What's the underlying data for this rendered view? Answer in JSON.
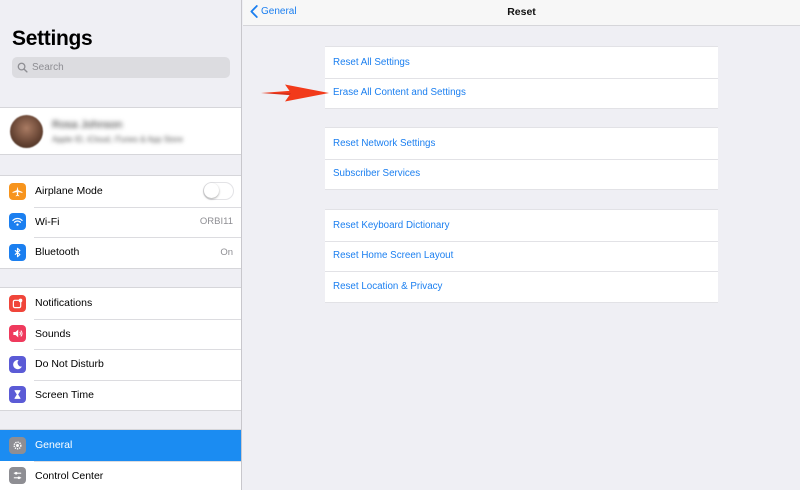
{
  "sidebar": {
    "title": "Settings",
    "search_placeholder": "Search",
    "profile": {
      "name": "Rosa Johnson",
      "subtitle": "Apple ID, iCloud, iTunes & App Store"
    },
    "groups": [
      [
        {
          "label": "Airplane Mode",
          "icon": "airplane-icon",
          "color": "#f7941d",
          "control": "toggle",
          "toggle_on": false
        },
        {
          "label": "Wi-Fi",
          "icon": "wifi-icon",
          "color": "#1b7ff0",
          "value": "ORBI11"
        },
        {
          "label": "Bluetooth",
          "icon": "bluetooth-icon",
          "color": "#1b7ff0",
          "value": "On"
        }
      ],
      [
        {
          "label": "Notifications",
          "icon": "notifications-icon",
          "color": "#f0453a"
        },
        {
          "label": "Sounds",
          "icon": "speaker-icon",
          "color": "#ef3a5d"
        },
        {
          "label": "Do Not Disturb",
          "icon": "moon-icon",
          "color": "#5b5bd6"
        },
        {
          "label": "Screen Time",
          "icon": "hourglass-icon",
          "color": "#5b5bd6"
        }
      ],
      [
        {
          "label": "General",
          "icon": "gear-icon",
          "color": "#8e8e93",
          "selected": true
        },
        {
          "label": "Control Center",
          "icon": "sliders-icon",
          "color": "#8e8e93"
        }
      ]
    ]
  },
  "header": {
    "back_label": "General",
    "title": "Reset"
  },
  "reset_groups": [
    [
      "Reset All Settings",
      "Erase All Content and Settings"
    ],
    [
      "Reset Network Settings",
      "Subscriber Services"
    ],
    [
      "Reset Keyboard Dictionary",
      "Reset Home Screen Layout",
      "Reset Location & Privacy"
    ]
  ],
  "colors": {
    "link": "#1b7ff0",
    "selected": "#1b8cf2",
    "annotation_arrow": "#f23a1a"
  }
}
